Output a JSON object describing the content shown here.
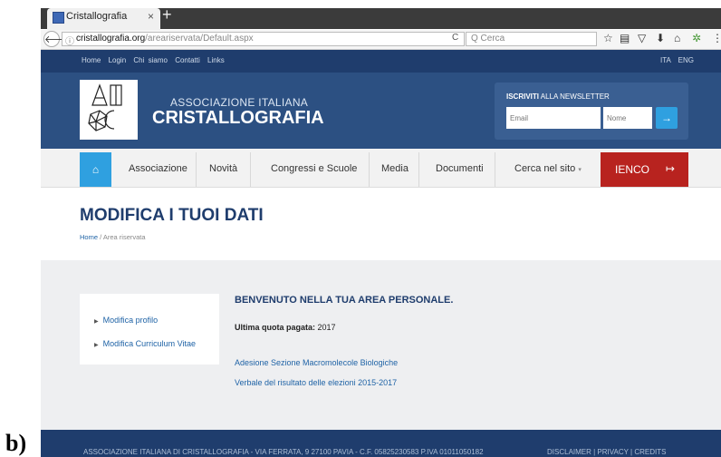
{
  "caption": "b)",
  "browser": {
    "tab_title": "Cristallografia",
    "tab_close": "×",
    "new_tab": "+",
    "back": "🡐",
    "info": "ⓘ",
    "url_host": "cristallografia.org",
    "url_path": "/areariservata/Default.aspx",
    "reload": "C",
    "search_placeholder": "Q Cerca",
    "toolbar_icons": [
      "star-icon",
      "reading-list-icon",
      "pocket-icon",
      "download-icon",
      "home-icon",
      "extension-icon",
      "menu-icon"
    ]
  },
  "site": {
    "top_links": [
      "Home",
      "Login",
      "Chi siamo",
      "Contatti",
      "Links"
    ],
    "langs": [
      "ITA",
      "ENG"
    ],
    "assoc_line1": "ASSOCIAZIONE ITALIANA",
    "assoc_line2": "CRISTALLOGRAFIA",
    "newsletter": {
      "title_bold": "ISCRIVITI",
      "title_rest": " ALLA NEWSLETTER",
      "email_placeholder": "Email",
      "name_placeholder": "Nome",
      "submit": "→"
    },
    "menu": {
      "home_icon": "⌂",
      "items": [
        "Associazione",
        "Novità",
        "Congressi e Scuole",
        "Media",
        "Documenti",
        "Cerca nel sito"
      ],
      "search_caret": "▾",
      "ienco_label": "IENCO",
      "ienco_icon": "↦"
    }
  },
  "content": {
    "page_title": "MODIFICA I TUOI DATI",
    "breadcrumb_home": "Home",
    "breadcrumb_current": " / Area riservata",
    "side_menu": [
      "Modifica profilo",
      "Modifica Curriculum Vitae"
    ],
    "welcome": "BENVENUTO NELLA TUA AREA PERSONALE.",
    "quota_label": "Ultima quota pagata:",
    "quota_value": " 2017",
    "links": [
      "Adesione Sezione Macromolecole Biologiche",
      "Verbale del risultato delle elezioni 2015-2017"
    ]
  },
  "footer": {
    "text": "ASSOCIAZIONE ITALIANA DI CRISTALLOGRAFIA - VIA FERRATA, 9 27100 PAVIA - C.F. 05825230583 P.IVA 01011050182",
    "links": "DISCLAIMER | PRIVACY | CREDITS"
  },
  "colors": {
    "navy": "#1f3d6d",
    "header_blue": "#2c5082",
    "accent_blue": "#2fa0e0",
    "ienco_red": "#b8231f"
  }
}
